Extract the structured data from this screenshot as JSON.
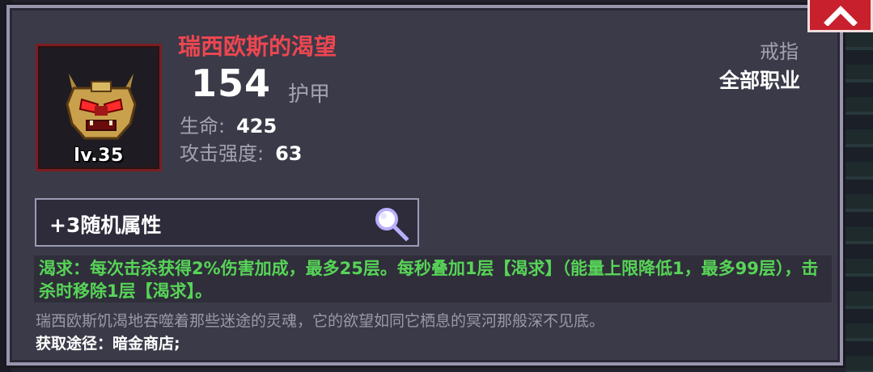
{
  "item": {
    "name": "瑞西欧斯的渴望",
    "level": "lv.35",
    "armor_value": "154",
    "armor_label": "护甲",
    "type": "戒指",
    "class_restriction": "全部职业",
    "stats": [
      {
        "label": "生命:",
        "value": "425"
      },
      {
        "label": "攻击强度:",
        "value": "63"
      }
    ],
    "icon": "demon-mask-icon"
  },
  "random_attributes": {
    "label": "+3随机属性",
    "icon": "magnifier-icon"
  },
  "effect": {
    "text": "渴求：每次击杀获得2%伤害加成，最多25层。每秒叠加1层【渴求】（能量上限降低1，最多99层），击杀时移除1层【渴求】。"
  },
  "lore": "瑞西欧斯饥渴地吞噬着那些迷途的灵魂，它的欲望如同它栖息的冥河那般深不见底。",
  "source": "获取途径：暗金商店;",
  "colors": {
    "name_red": "#ee4650",
    "effect_green": "#57d457",
    "panel": "#3a3a48",
    "close_red": "#c8202c"
  }
}
